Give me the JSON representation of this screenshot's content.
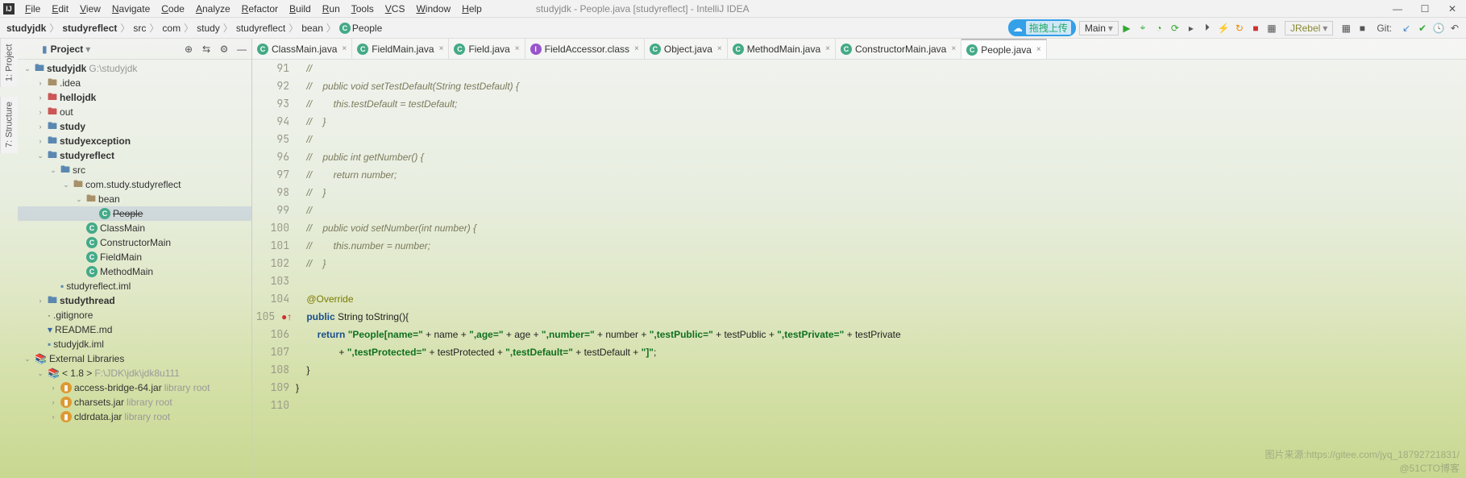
{
  "title": {
    "app": "IJ",
    "text": "studyjdk - People.java [studyreflect] - IntelliJ IDEA"
  },
  "menu": [
    "File",
    "Edit",
    "View",
    "Navigate",
    "Code",
    "Analyze",
    "Refactor",
    "Build",
    "Run",
    "Tools",
    "VCS",
    "Window",
    "Help"
  ],
  "breadcrumbs": [
    {
      "label": "studyjdk",
      "bold": true
    },
    {
      "label": "studyreflect",
      "bold": true
    },
    {
      "label": "src"
    },
    {
      "label": "com"
    },
    {
      "label": "study"
    },
    {
      "label": "studyreflect"
    },
    {
      "label": "bean"
    },
    {
      "label": "People",
      "icon": "class"
    }
  ],
  "run": {
    "badge": "拖拽上传",
    "config": "Main"
  },
  "rightToolbar": [
    "run",
    "debug",
    "coverage",
    "profiler",
    "sep",
    "next",
    "attach",
    "dbg2",
    "rerun",
    "sep",
    "stop",
    "grid",
    "sep"
  ],
  "git": {
    "label": "Git:"
  },
  "jrebel": "JRebel",
  "projectLabel": "Project",
  "tree": [
    {
      "d": 0,
      "arrow": "v",
      "icon": "folder blue",
      "text": "studyjdk",
      "hint": " G:\\studyjdk",
      "bold": true
    },
    {
      "d": 1,
      "arrow": ">",
      "icon": "folder",
      "text": ".idea"
    },
    {
      "d": 1,
      "arrow": ">",
      "icon": "folder red",
      "text": "hellojdk",
      "bold": true
    },
    {
      "d": 1,
      "arrow": ">",
      "icon": "folder red",
      "text": "out"
    },
    {
      "d": 1,
      "arrow": ">",
      "icon": "folder blue",
      "text": "study",
      "bold": true
    },
    {
      "d": 1,
      "arrow": ">",
      "icon": "folder blue",
      "text": "studyexception",
      "bold": true
    },
    {
      "d": 1,
      "arrow": "v",
      "icon": "folder blue",
      "text": "studyreflect",
      "bold": true
    },
    {
      "d": 2,
      "arrow": "v",
      "icon": "folder blue",
      "text": "src"
    },
    {
      "d": 3,
      "arrow": "v",
      "icon": "folder",
      "text": "com.study.studyreflect"
    },
    {
      "d": 4,
      "arrow": "v",
      "icon": "folder",
      "text": "bean"
    },
    {
      "d": 5,
      "arrow": "",
      "icon": "class",
      "text": "People",
      "sel": true,
      "strike": true
    },
    {
      "d": 4,
      "arrow": "",
      "icon": "class",
      "text": "ClassMain"
    },
    {
      "d": 4,
      "arrow": "",
      "icon": "class",
      "text": "ConstructorMain"
    },
    {
      "d": 4,
      "arrow": "",
      "icon": "class",
      "text": "FieldMain"
    },
    {
      "d": 4,
      "arrow": "",
      "icon": "class",
      "text": "MethodMain"
    },
    {
      "d": 2,
      "arrow": "",
      "icon": "iml",
      "text": "studyreflect.iml"
    },
    {
      "d": 1,
      "arrow": ">",
      "icon": "folder blue",
      "text": "studythread",
      "bold": true
    },
    {
      "d": 1,
      "arrow": "",
      "icon": "file",
      "text": ".gitignore"
    },
    {
      "d": 1,
      "arrow": "",
      "icon": "md",
      "text": "README.md"
    },
    {
      "d": 1,
      "arrow": "",
      "icon": "iml",
      "text": "studyjdk.iml"
    },
    {
      "d": 0,
      "arrow": "v",
      "icon": "lib",
      "text": "External Libraries"
    },
    {
      "d": 1,
      "arrow": "v",
      "icon": "lib",
      "text": "< 1.8 >",
      "hint": " F:\\JDK\\jdk\\jdk8u111"
    },
    {
      "d": 2,
      "arrow": ">",
      "icon": "jar",
      "text": "access-bridge-64.jar",
      "hint": " library root"
    },
    {
      "d": 2,
      "arrow": ">",
      "icon": "jar",
      "text": "charsets.jar",
      "hint": " library root"
    },
    {
      "d": 2,
      "arrow": ">",
      "icon": "jar",
      "text": "cldrdata.jar",
      "hint": " library root"
    }
  ],
  "tabs": [
    {
      "label": "ClassMain.java",
      "icon": "class"
    },
    {
      "label": "FieldMain.java",
      "icon": "class"
    },
    {
      "label": "Field.java",
      "icon": "class"
    },
    {
      "label": "FieldAccessor.class",
      "icon": "iface"
    },
    {
      "label": "Object.java",
      "icon": "class"
    },
    {
      "label": "MethodMain.java",
      "icon": "class"
    },
    {
      "label": "ConstructorMain.java",
      "icon": "class"
    },
    {
      "label": "People.java",
      "icon": "class",
      "active": true
    }
  ],
  "code": {
    "first": 91,
    "lines": [
      {
        "t": "//",
        "c": "comment"
      },
      {
        "t": "//    public void setTestDefault(String testDefault) {",
        "c": "comment"
      },
      {
        "t": "//        this.testDefault = testDefault;",
        "c": "comment"
      },
      {
        "t": "//    }",
        "c": "comment"
      },
      {
        "t": "//",
        "c": "comment"
      },
      {
        "t": "//    public int getNumber() {",
        "c": "comment"
      },
      {
        "t": "//        return number;",
        "c": "comment"
      },
      {
        "t": "//    }",
        "c": "comment"
      },
      {
        "t": "//",
        "c": "comment"
      },
      {
        "t": "//    public void setNumber(int number) {",
        "c": "comment"
      },
      {
        "t": "//        this.number = number;",
        "c": "comment"
      },
      {
        "t": "//    }",
        "c": "comment"
      },
      {
        "t": "",
        "c": "plain"
      },
      {
        "t": "    @Override",
        "c": "anno"
      },
      {
        "t": "    public String toString(){",
        "c": "sig",
        "marker": true
      },
      {
        "t": "        return \"People[name=\" + name + \",age=\" + age + \",number=\" + number + \",testPublic=\" + testPublic + \",testPrivate=\" + testPrivate",
        "c": "ret"
      },
      {
        "t": "                + \",testProtected=\" + testProtected + \",testDefault=\" + testDefault + \"]\";",
        "c": "str"
      },
      {
        "t": "    }",
        "c": "plain"
      },
      {
        "t": "}",
        "c": "plain"
      },
      {
        "t": "",
        "c": "plain"
      }
    ]
  },
  "watermark": "图片来源:https://gitee.com/jyq_18792721831/",
  "watermark2": "@51CTO博客"
}
